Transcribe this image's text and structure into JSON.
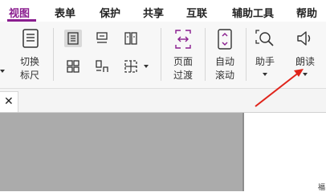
{
  "menu": {
    "tabs": [
      "视图",
      "表单",
      "保护",
      "共享",
      "互联",
      "辅助工具",
      "帮助"
    ],
    "active_tab": "视图"
  },
  "ribbon": {
    "ruler": {
      "label_line1": "切换",
      "label_line2": "标尺"
    },
    "page_transition": {
      "label_line1": "页面",
      "label_line2": "过渡"
    },
    "auto_scroll": {
      "label_line1": "自动",
      "label_line2": "滚动"
    },
    "assistant": {
      "label": "助手"
    },
    "read_aloud": {
      "label": "朗读"
    }
  },
  "document": {
    "page_text": "福"
  },
  "colors": {
    "accent": "#8a1d8f",
    "annotation_arrow": "#e0241b",
    "workspace_gray": "#ababab"
  }
}
